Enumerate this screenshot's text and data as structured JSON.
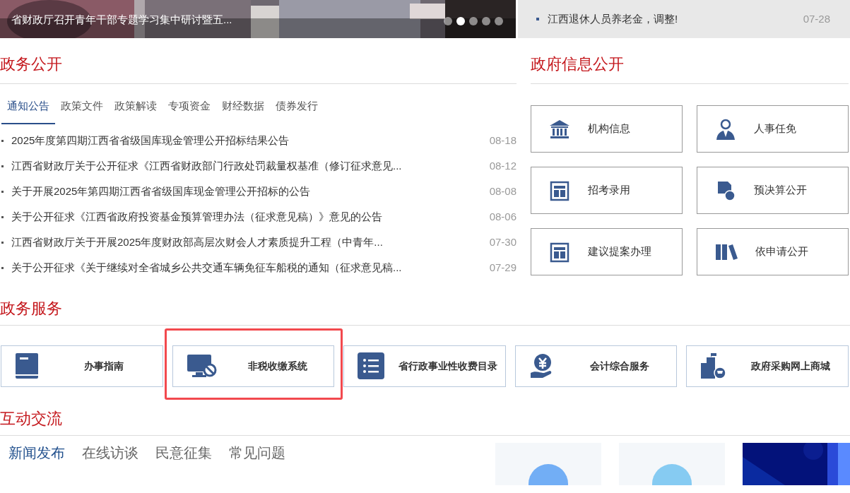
{
  "slideshow": {
    "caption": "省财政厅召开青年干部专题学习集中研讨暨五...",
    "dots": [
      {
        "selected": false
      },
      {
        "selected": true
      },
      {
        "selected": false
      },
      {
        "selected": false
      },
      {
        "selected": false
      }
    ]
  },
  "top_news": {
    "title": "江西退休人员养老金，调整!",
    "date": "07-28"
  },
  "gov_affairs": {
    "title": "政务公开",
    "tabs": [
      {
        "label": "通知公告",
        "selected": true
      },
      {
        "label": "政策文件",
        "selected": false
      },
      {
        "label": "政策解读",
        "selected": false
      },
      {
        "label": "专项资金",
        "selected": false
      },
      {
        "label": "财经数据",
        "selected": false
      },
      {
        "label": "债券发行",
        "selected": false
      }
    ],
    "news": [
      {
        "title": "2025年度第四期江西省省级国库现金管理公开招标结果公告",
        "date": "08-18"
      },
      {
        "title": "江西省财政厅关于公开征求《江西省财政部门行政处罚裁量权基准（修订征求意见...",
        "date": "08-12"
      },
      {
        "title": "关于开展2025年第四期江西省省级国库现金管理公开招标的公告",
        "date": "08-08"
      },
      {
        "title": "关于公开征求《江西省政府投资基金预算管理办法（征求意见稿）》意见的公告",
        "date": "08-06"
      },
      {
        "title": "江西省财政厅关于开展2025年度财政部高层次财会人才素质提升工程（中青年...",
        "date": "07-30"
      },
      {
        "title": "关于公开征求《关于继续对全省城乡公共交通车辆免征车船税的通知（征求意见稿...",
        "date": "07-29"
      }
    ]
  },
  "info_disclosure": {
    "title": "政府信息公开",
    "items": [
      "机构信息",
      "人事任免",
      "招考录用",
      "预决算公开",
      "建议提案办理",
      "依申请公开"
    ]
  },
  "services": {
    "title": "政务服务",
    "items": [
      {
        "label": "办事指南",
        "highlighted": false
      },
      {
        "label": "非税收缴系统",
        "highlighted": true
      },
      {
        "label": "省行政事业性收费目录",
        "highlighted": false
      },
      {
        "label": "会计综合服务",
        "highlighted": false
      },
      {
        "label": "政府采购网上商城",
        "highlighted": false
      }
    ]
  },
  "interaction": {
    "title": "互动交流",
    "tabs": [
      {
        "label": "新闻发布",
        "selected": true
      },
      {
        "label": "在线访谈",
        "selected": false
      },
      {
        "label": "民意征集",
        "selected": false
      },
      {
        "label": "常见问题",
        "selected": false
      }
    ],
    "cards": [
      {
        "kind": "icon"
      },
      {
        "kind": "icon"
      },
      {
        "kind": "picture"
      }
    ]
  }
}
